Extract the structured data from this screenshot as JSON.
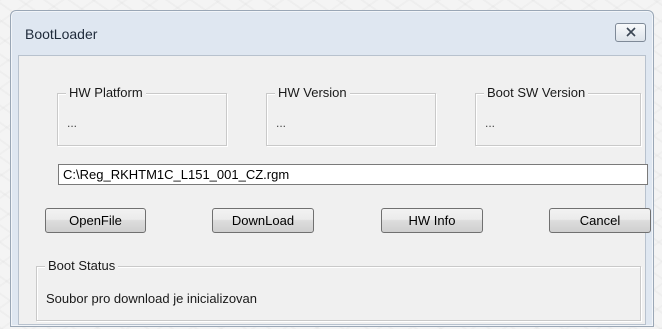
{
  "window": {
    "title": "BootLoader"
  },
  "info_groups": {
    "hw_platform": {
      "label": "HW Platform",
      "value": "..."
    },
    "hw_version": {
      "label": "HW Version",
      "value": "..."
    },
    "boot_sw_version": {
      "label": "Boot SW Version",
      "value": "..."
    }
  },
  "file_path": {
    "value": "C:\\Reg_RKHTM1C_L151_001_CZ.rgm"
  },
  "buttons": {
    "open_file": "OpenFile",
    "download": "DownLoad",
    "hw_info": "HW Info",
    "cancel": "Cancel"
  },
  "boot_status": {
    "label": "Boot Status",
    "text": "Soubor pro download je inicializovan"
  },
  "icons": {
    "close": "close-icon"
  },
  "colors": {
    "frame": "#dfe7f1",
    "client": "#f0f0f0"
  }
}
